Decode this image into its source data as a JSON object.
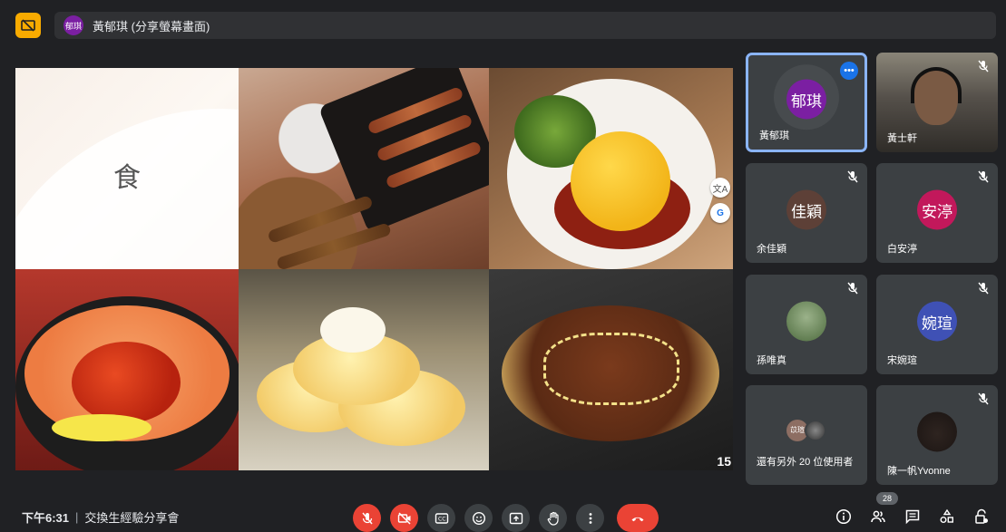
{
  "presentation": {
    "presenter_initials": "郁琪",
    "title": "黃郁琪 (分享螢幕畫面)"
  },
  "slide": {
    "heading_char": "食",
    "page_number": "15"
  },
  "side_tools": [
    "translate-icon",
    "google-lens-icon"
  ],
  "participants": [
    {
      "name": "黃郁琪",
      "initials": "郁琪",
      "color": "#7b1fa2",
      "active": true
    },
    {
      "name": "黃士軒",
      "video": true
    },
    {
      "name": "余佳穎",
      "initials": "佳穎",
      "color": "#5d4037"
    },
    {
      "name": "白安渟",
      "initials": "安渟",
      "color": "#c2185b"
    },
    {
      "name": "孫唯真",
      "photo": true
    },
    {
      "name": "宋婉瑄",
      "initials": "婉瑄",
      "color": "#3f51b5"
    },
    {
      "name": "還有另外 20 位使用者",
      "other_initials": "苡瑄"
    },
    {
      "name": "陳一帆Yvonne",
      "photo": true
    }
  ],
  "footer": {
    "time": "下午6:31",
    "separator": "|",
    "meeting_title": "交換生經驗分享會"
  },
  "people_count": "28",
  "colors": {
    "accent": "#f9ab00",
    "danger": "#ea4335",
    "active_border": "#8ab4f8",
    "tile_bg": "#3c4043"
  }
}
